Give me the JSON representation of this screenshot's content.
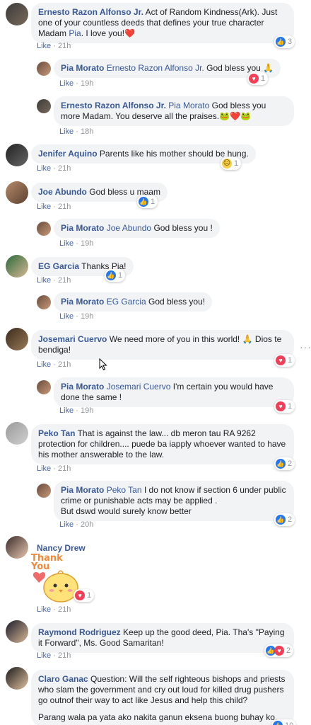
{
  "comments": [
    {
      "name": "Ernesto Razon Alfonso Jr.",
      "text": "Act of Random Kindness(Ark). Just one of your countless deeds that defines your true character Madam ",
      "mention": "Pia",
      "text2": ". I love you!",
      "emoji": "❤️",
      "like": "Like",
      "time": "21h",
      "reactions": "3",
      "replies": [
        {
          "name": "Pia Morato",
          "mention": "Ernesto Razon Alfonso Jr.",
          "text": "God bless you ",
          "emoji": "🙏",
          "like": "Like",
          "time": "19h",
          "reactions": "1"
        },
        {
          "name": "Ernesto Razon Alfonso Jr.",
          "mention": "Pia Morato",
          "text": "God bless you more Madam. You deserve all the praises.",
          "emoji": "🐸❤️🐸",
          "like": "Like",
          "time": "18h"
        }
      ]
    },
    {
      "name": "Jenifer Aquino",
      "text": "Parents like his mother should be hung.",
      "like": "Like",
      "time": "21h",
      "reactions": "1"
    },
    {
      "name": "Joe Abundo",
      "text": "God bless u maam",
      "like": "Like",
      "time": "21h",
      "reactions": "1",
      "replies": [
        {
          "name": "Pia Morato",
          "mention": "Joe Abundo",
          "text": "God bless you !",
          "like": "Like",
          "time": "19h"
        }
      ]
    },
    {
      "name": "EG Garcia",
      "text": "Thanks Pia!",
      "like": "Like",
      "time": "21h",
      "reactions": "1",
      "replies": [
        {
          "name": "Pia Morato",
          "mention": "EG Garcia",
          "text": "God bless you!",
          "like": "Like",
          "time": "19h"
        }
      ]
    },
    {
      "name": "Josemari Cuervo",
      "text": "We need more of you in this world! ",
      "emoji": "🙏",
      "text2": " Dios te bendiga!",
      "like": "Like",
      "time": "21h",
      "reactions": "1",
      "replies": [
        {
          "name": "Pia Morato",
          "mention": "Josemari Cuervo",
          "text": "I'm certain you would have done the same !",
          "like": "Like",
          "time": "19h",
          "reactions": "1"
        }
      ]
    },
    {
      "name": "Peko Tan",
      "text": "That is against the law... db meron tau RA 9262 protection for children.... puede ba iapply whoever wanted to have his mother answerable to the law.",
      "like": "Like",
      "time": "21h",
      "reactions": "2",
      "replies": [
        {
          "name": "Pia Morato",
          "mention": "Peko Tan",
          "text": "I do not know if section 6 under public crime or punishable acts may be applied .",
          "text2": "But dswd would surely know better",
          "like": "Like",
          "time": "20h",
          "reactions": "2"
        }
      ]
    },
    {
      "name": "Nancy Drew",
      "sticker_text": "Thank You",
      "like": "Like",
      "time": "21h",
      "reactions": "1"
    },
    {
      "name": "Raymond Rodriguez",
      "text": "Keep up the good deed, Pia. Tha's \"Paying it Forward\", Ms. Good Samaritan!",
      "like": "Like",
      "time": "21h",
      "reactions": "2"
    },
    {
      "name": "Claro Ganac",
      "text": "Question: Will the self righteous bishops and priests who slam the government and cry out loud for killed drug pushers go outnof their way to act like Jesus and help this child?",
      "text2": "Parang wala pa yata ako nakita ganun eksena buong buhay ko.",
      "reactions": "10"
    }
  ],
  "colors": {
    "name": "#385898",
    "bubble": "#f2f3f5",
    "meta": "#90949c",
    "like": "#2078f4",
    "love": "#f33e58"
  }
}
